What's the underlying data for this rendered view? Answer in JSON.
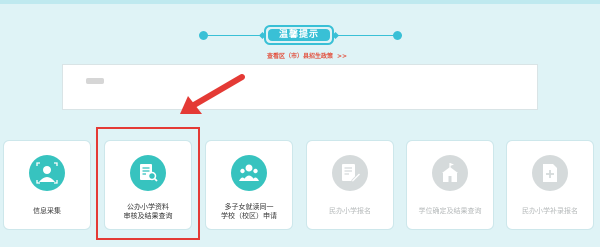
{
  "header": {
    "title": "温馨提示",
    "subnote_text": "查看区（市）县招生政策",
    "subnote_link": ">>"
  },
  "colors": {
    "accent": "#39c0d6",
    "active_icon": "#37c3bf",
    "disabled_icon": "#d5dadb",
    "highlight": "#e43a35",
    "background": "#dff3f6"
  },
  "cards": [
    {
      "line1": "信息采集",
      "line2": "",
      "icon": "person-info-icon",
      "state": "active"
    },
    {
      "line1": "公办小学资料",
      "line2": "审核及结果查询",
      "icon": "document-search-icon",
      "state": "active"
    },
    {
      "line1": "多子女就读同一",
      "line2": "学校（校区）申请",
      "icon": "group-children-icon",
      "state": "active"
    },
    {
      "line1": "民办小学报名",
      "line2": "",
      "icon": "edit-form-icon",
      "state": "disabled"
    },
    {
      "line1": "学位确定及结果查询",
      "line2": "",
      "icon": "school-building-icon",
      "state": "disabled"
    },
    {
      "line1": "民办小学补录报名",
      "line2": "",
      "icon": "add-document-icon",
      "state": "disabled"
    }
  ]
}
